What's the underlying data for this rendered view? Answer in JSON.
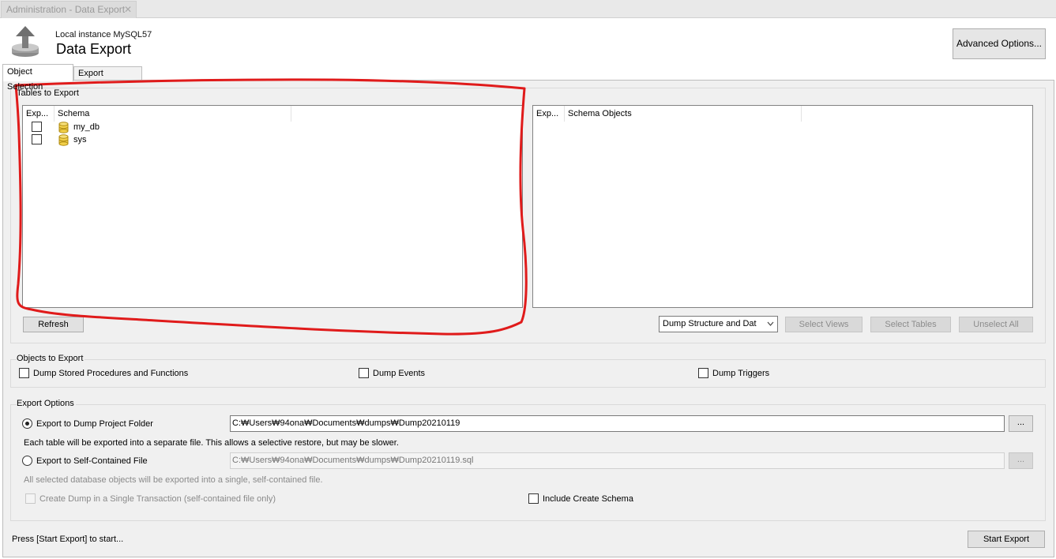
{
  "doc_tab": {
    "title": "Administration - Data Export",
    "close": "✕"
  },
  "header": {
    "instance": "Local instance MySQL57",
    "title": "Data Export",
    "advanced_btn": "Advanced Options..."
  },
  "tabs": {
    "object_selection": "Object Selection",
    "export_progress": "Export Progress"
  },
  "tables_to_export": {
    "label": "Tables to Export",
    "schema_list": {
      "columns": [
        "Exp...",
        "Schema"
      ],
      "rows": [
        {
          "checked": false,
          "name": "my_db"
        },
        {
          "checked": false,
          "name": "sys"
        }
      ]
    },
    "objects_list": {
      "columns": [
        "Exp...",
        "Schema Objects"
      ]
    },
    "refresh_btn": "Refresh",
    "dump_mode": "Dump Structure and Dat",
    "select_views_btn": "Select Views",
    "select_tables_btn": "Select Tables",
    "unselect_all_btn": "Unselect All"
  },
  "objects_to_export": {
    "label": "Objects to Export",
    "stored_procs": "Dump Stored Procedures and Functions",
    "events": "Dump Events",
    "triggers": "Dump Triggers"
  },
  "export_options": {
    "label": "Export Options",
    "dump_folder_label": "Export to Dump Project Folder",
    "dump_folder_path": "C:₩Users₩94ona₩Documents₩dumps₩Dump20210119",
    "dump_folder_desc": "Each table will be exported into a separate file. This allows a selective restore, but may be slower.",
    "self_file_label": "Export to Self-Contained File",
    "self_file_path": "C:₩Users₩94ona₩Documents₩dumps₩Dump20210119.sql",
    "self_file_desc": "All selected database objects will be exported into a single, self-contained file.",
    "single_txn": "Create Dump in a Single Transaction (self-contained file only)",
    "include_schema": "Include Create Schema",
    "browse": "..."
  },
  "footer": {
    "status": "Press [Start Export] to start...",
    "start_btn": "Start Export"
  },
  "colors": {
    "annotation_red": "#e01b1b",
    "panel_bg": "#f0f0f0"
  }
}
